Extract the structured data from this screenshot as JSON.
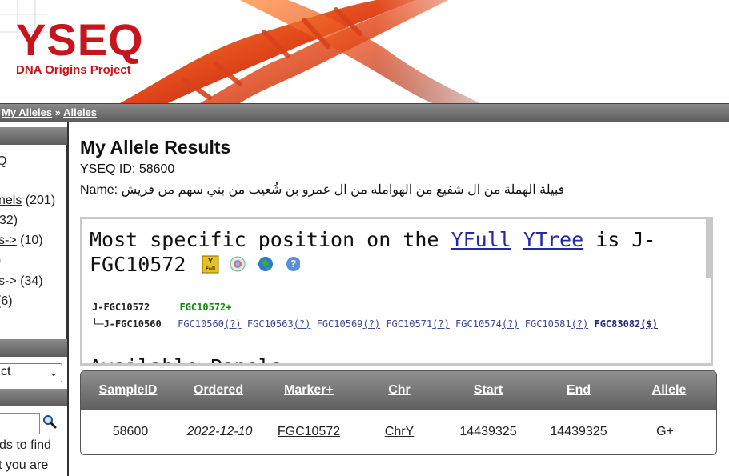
{
  "header": {
    "logo_title": "YSEQ",
    "logo_subtitle": "DNA Origins Project",
    "colors": {
      "brand_red": "#c8141c",
      "bar_gray": "#6e6e6e"
    }
  },
  "breadcrumb": {
    "items": [
      "My Alleles",
      "Alleles"
    ],
    "separator": "»"
  },
  "sidebar": {
    "lines": [
      {
        "link": "Q",
        "suffix": ""
      },
      {
        "link": "nels",
        "suffix": " (201)"
      },
      {
        "link": "",
        "suffix": "32)"
      },
      {
        "link": "s->",
        "suffix": " (10)"
      },
      {
        "link": "",
        "suffix": ")"
      },
      {
        "link": "s->",
        "suffix": " (34)"
      },
      {
        "link": "",
        "suffix": " (6)"
      }
    ],
    "select_value": "ct",
    "help_line_1": "ds to find",
    "help_line_2": "t you are"
  },
  "main": {
    "title": "My Allele Results",
    "yseq_id_label": "YSEQ ID:",
    "yseq_id": "58600",
    "name_label": "Name:",
    "name_value": "قبيلة الهملة من ال شفيع من الهوامله من ال عمرو بن شُعيب من بني سهم من قريش"
  },
  "tree": {
    "headline_prefix": "Most specific position on the",
    "link_yfull": "YFull",
    "link_ytree": "YTree",
    "headline_is": "is J-",
    "headline_clade": "FGC10572",
    "icons": [
      "yfull-icon",
      "ybrowse-icon",
      "globe-icon",
      "help-icon"
    ],
    "icon_yfull_text": "Y Full",
    "icon_help_text": "?",
    "node1": "J-FGC10572",
    "node1_snp": "FGC10572+",
    "node2_prefix": "└─",
    "node2": "J-FGC10560",
    "snps": [
      {
        "name": "FGC10560",
        "mark": "(?)"
      },
      {
        "name": "FGC10563",
        "mark": "(?)"
      },
      {
        "name": "FGC10569",
        "mark": "(?)"
      },
      {
        "name": "FGC10571",
        "mark": "(?)"
      },
      {
        "name": "FGC10574",
        "mark": "(?)"
      },
      {
        "name": "FGC10581",
        "mark": "(?)"
      }
    ],
    "snp_bold": {
      "name": "FGC83082",
      "mark": "($)"
    },
    "cut_text": "Available Panels"
  },
  "results": {
    "columns": [
      "SampleID",
      "Ordered",
      "Marker+",
      "Chr",
      "Start",
      "End",
      "Allele"
    ],
    "rows": [
      [
        "58600",
        "2022-12-10",
        "FGC10572",
        "ChrY",
        "14439325",
        "14439325",
        "G+"
      ]
    ]
  }
}
